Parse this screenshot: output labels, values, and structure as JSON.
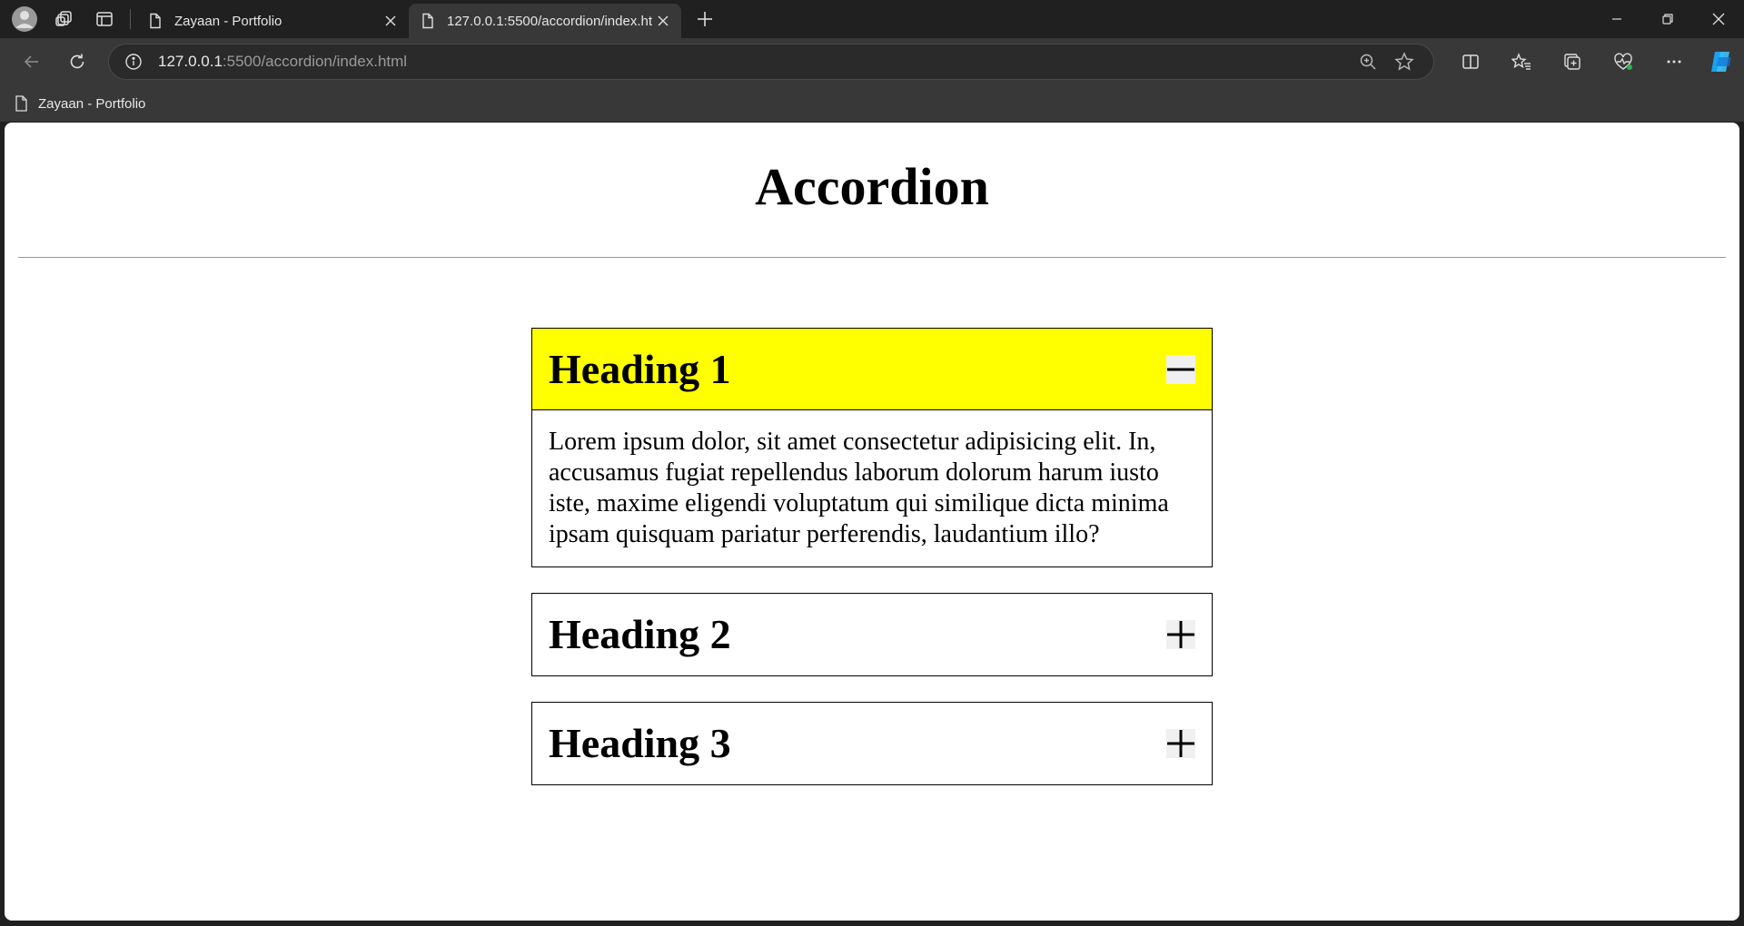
{
  "browser": {
    "tabs": [
      {
        "title": "Zayaan - Portfolio",
        "active": false
      },
      {
        "title": "127.0.0.1:5500/accordion/index.ht",
        "active": true
      }
    ],
    "address": {
      "host": "127.0.0.1",
      "rest": ":5500/accordion/index.html"
    },
    "favorites": [
      {
        "label": "Zayaan - Portfolio"
      }
    ]
  },
  "page": {
    "title": "Accordion",
    "accordion": [
      {
        "heading": "Heading 1",
        "expanded": true,
        "toggle_symbol": "minus",
        "body": "Lorem ipsum dolor, sit amet consectetur adipisicing elit. In, accusamus fugiat repellendus laborum dolorum harum iusto iste, maxime eligendi voluptatum qui similique dicta minima ipsam quisquam pariatur perferendis, laudantium illo?"
      },
      {
        "heading": "Heading 2",
        "expanded": false,
        "toggle_symbol": "plus"
      },
      {
        "heading": "Heading 3",
        "expanded": false,
        "toggle_symbol": "plus"
      }
    ],
    "colors": {
      "active_header": "#ffff00",
      "border": "#000000"
    }
  }
}
